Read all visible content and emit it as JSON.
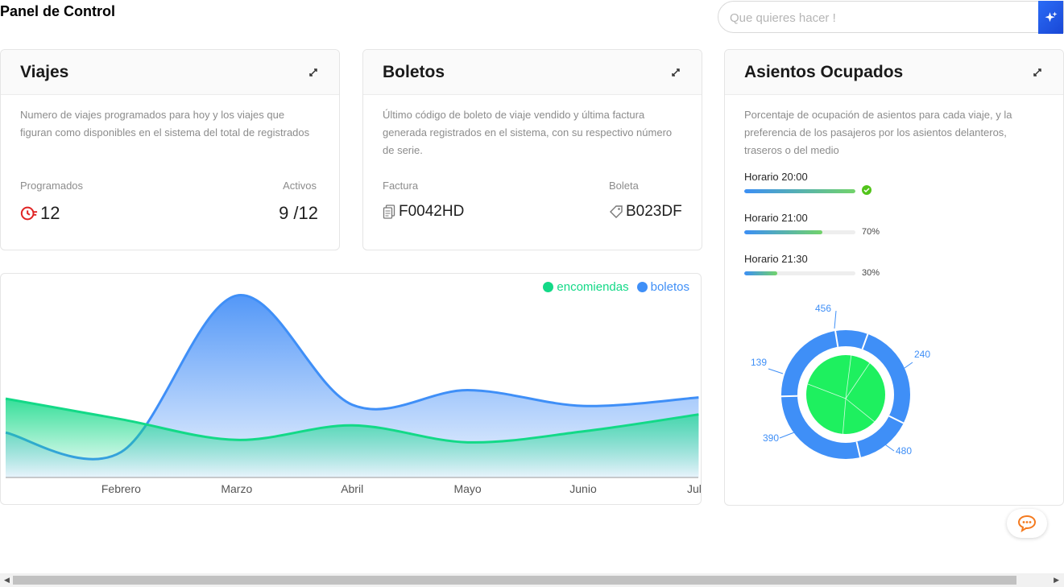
{
  "header": {
    "title": "Panel de Control"
  },
  "search": {
    "placeholder": "Que quieres hacer !",
    "ai_icon": "sparkle-icon"
  },
  "viajes": {
    "title": "Viajes",
    "description": "Numero de viajes programados para hoy y los viajes que figuran como disponibles en el sistema del total de registrados",
    "programados_label": "Programados",
    "programados_value": "12",
    "activos_label": "Activos",
    "activos_value": "9 /12",
    "icon": "clock-alert-icon",
    "icon_color": "#e02424"
  },
  "boletos": {
    "title": "Boletos",
    "description": "Último código de boleto de viaje vendido y última factura generada registrados en el sistema, con su respectivo número de serie.",
    "factura_label": "Factura",
    "factura_value": "F0042HD",
    "boleta_label": "Boleta",
    "boleta_value": "B023DF"
  },
  "asientos": {
    "title": "Asientos Ocupados",
    "description": "Porcentaje de ocupación de asientos para cada viaje, y la preferencia de los pasajeros por los asientos delanteros, traseros o del medio",
    "rows": [
      {
        "label": "Horario 20:00",
        "percent": 100,
        "pct_text": ""
      },
      {
        "label": "Horario 21:00",
        "percent": 70,
        "pct_text": "70%"
      },
      {
        "label": "Horario 21:30",
        "percent": 30,
        "pct_text": "30%"
      }
    ],
    "ring_labels": [
      "456",
      "240",
      "139",
      "390",
      "480"
    ],
    "ring_values": [
      456,
      240,
      480,
      390,
      139
    ],
    "ring_color": "#3f8ff7",
    "inner_color": "#1ef05f"
  },
  "chart_data": {
    "type": "area",
    "categories": [
      "Febrero",
      "Marzo",
      "Abril",
      "Mayo",
      "Junio",
      "Julio"
    ],
    "series": [
      {
        "name": "encomiendas",
        "color": "#13d987",
        "values": [
          65,
          48,
          31,
          43,
          29,
          38,
          52
        ]
      },
      {
        "name": "boletos",
        "color": "#3f8ff7",
        "values": [
          37,
          21,
          150,
          60,
          72,
          59,
          66
        ]
      }
    ],
    "ylim": [
      0,
      160
    ],
    "legend": "top-right"
  },
  "colors": {
    "accent": "#2b6cf6",
    "chat": "#f47a1f"
  }
}
